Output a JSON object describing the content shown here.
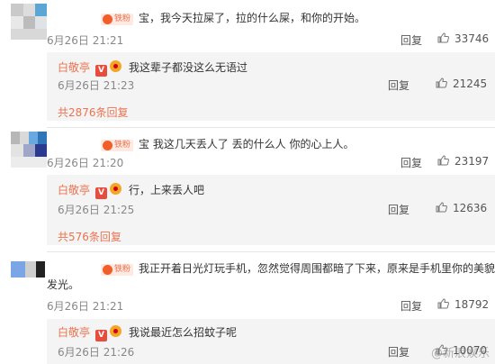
{
  "labels": {
    "reply": "回复"
  },
  "comments": [
    {
      "text": "宝，我今天拉屎了，拉的什么屎，和你的开始。",
      "badge": "铁粉",
      "time": "6月26日 21:21",
      "likes": "33746",
      "reply": {
        "name": "白敬亭",
        "text": "我这辈子都没这么无语过",
        "time": "6月26日 21:23",
        "likes": "21245"
      },
      "more": "共2876条回复"
    },
    {
      "text": "宝 我这几天丢人了 丢的什么人 你的心上人。",
      "badge": "铁粉",
      "time": "6月26日 21:20",
      "likes": "23197",
      "reply": {
        "name": "白敬亭",
        "text": "行，上来丢人吧",
        "time": "6月26日 21:25",
        "likes": "12636"
      },
      "more": "共576条回复"
    },
    {
      "text_line1": "我正开着日光灯玩手机，忽然觉得周围都暗了下来，原来是手机里你的美貌在",
      "text_line2": "发光。",
      "badge": "铁粉",
      "time": "6月26日 21:21",
      "likes": "18792",
      "reply": {
        "name": "白敬亭",
        "text": "我说最近怎么招蚊子呢",
        "time": "6月26日 21:26",
        "likes": "10070"
      }
    }
  ],
  "watermark": "@新浪娱乐",
  "colors": {
    "accent": "#eb7350",
    "reply_bg": "#f4f4f4"
  }
}
